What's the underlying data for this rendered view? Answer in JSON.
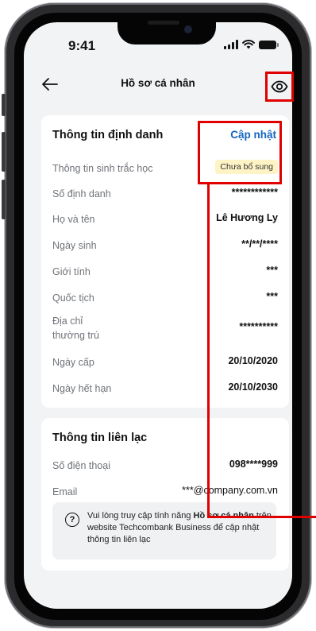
{
  "status_bar": {
    "time": "9:41"
  },
  "header": {
    "title": "Hồ sơ cá nhân"
  },
  "identity": {
    "title": "Thông tin định danh",
    "update_label": "Cập nhật",
    "rows": [
      {
        "label": "Thông tin sinh trắc học",
        "badge": "Chưa bổ sung"
      },
      {
        "label": "Số định danh",
        "value": "************"
      },
      {
        "label": "Họ và tên",
        "value": "Lê Hương Ly"
      },
      {
        "label": "Ngày sinh",
        "value": "**/**/****"
      },
      {
        "label": "Giới tính",
        "value": "***"
      },
      {
        "label": "Quốc tịch",
        "value": "***"
      },
      {
        "label_line1": "Địa chỉ",
        "label_line2": "thường trú",
        "value": "**********"
      },
      {
        "label": "Ngày cấp",
        "value": "20/10/2020"
      },
      {
        "label": "Ngày hết hạn",
        "value": "20/10/2030"
      }
    ]
  },
  "contact": {
    "title": "Thông tin liên lạc",
    "rows": [
      {
        "label": "Số điện thoại",
        "value": "098****999"
      },
      {
        "label": "Email",
        "value": "***@company.com.vn"
      }
    ],
    "info_icon": "?",
    "info_text_1": "Vui lòng truy cập tính năng ",
    "info_text_bold": "Hồ sơ cá nhân",
    "info_text_2": " trên website Techcombank Business để cập nhật thông tin liên lạc"
  },
  "colors": {
    "accent": "#1565c0",
    "highlight": "#e00000",
    "badge_bg": "#fdf3c4"
  }
}
